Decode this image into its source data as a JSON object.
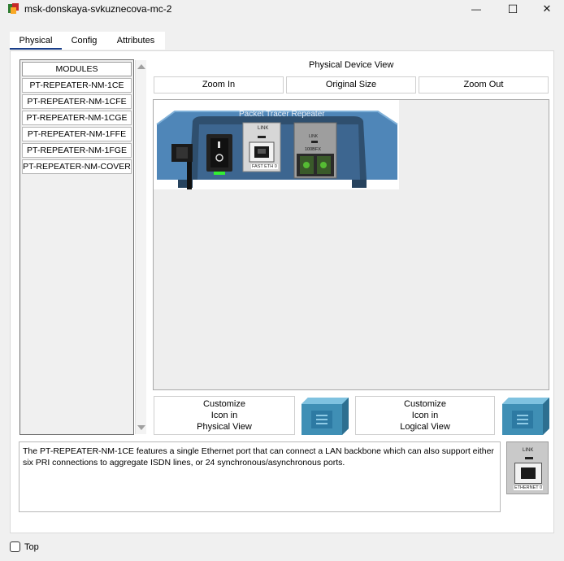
{
  "window": {
    "title": "msk-donskaya-svkuznecova-mc-2",
    "minimize_glyph": "—",
    "maximize_glyph": "☐",
    "close_glyph": "✕"
  },
  "tabs": [
    {
      "label": "Physical",
      "active": true
    },
    {
      "label": "Config",
      "active": false
    },
    {
      "label": "Attributes",
      "active": false
    }
  ],
  "modules": {
    "header": "MODULES",
    "items": [
      "PT-REPEATER-NM-1CE",
      "PT-REPEATER-NM-1CFE",
      "PT-REPEATER-NM-1CGE",
      "PT-REPEATER-NM-1FFE",
      "PT-REPEATER-NM-1FGE",
      "PT-REPEATER-NM-COVER"
    ]
  },
  "device_view": {
    "title": "Physical Device View",
    "zoom_in": "Zoom In",
    "original_size": "Original Size",
    "zoom_out": "Zoom Out",
    "device_label": "Packet Tracer Repeater",
    "port1_link": "LINK",
    "port1_name": "FAST ETH 0",
    "port2_link": "LINK",
    "port2_name": "100BFX"
  },
  "customize": {
    "physical_lines": [
      "Customize",
      "Icon in",
      "Physical View"
    ],
    "logical_lines": [
      "Customize",
      "Icon in",
      "Logical View"
    ]
  },
  "description": "The PT-REPEATER-NM-1CE features a single Ethernet port that can connect a LAN backbone which can also support either six PRI connections to aggregate ISDN lines, or 24 synchronous/asynchronous ports.",
  "module_thumb": {
    "link": "LINK",
    "name": "ETHERNET 0"
  },
  "footer": {
    "top_label": "Top",
    "top_checked": false
  },
  "colors": {
    "device_blue": "#4f86b8",
    "device_dark": "#2f4f6e",
    "tab_accent": "#1a3f8a",
    "led_green": "#33cc33",
    "icon_teal": "#3f8fb5"
  },
  "icons": {
    "app": "packet-tracer-app-icon",
    "scroll_up": "triangle-up",
    "scroll_down": "triangle-down"
  }
}
